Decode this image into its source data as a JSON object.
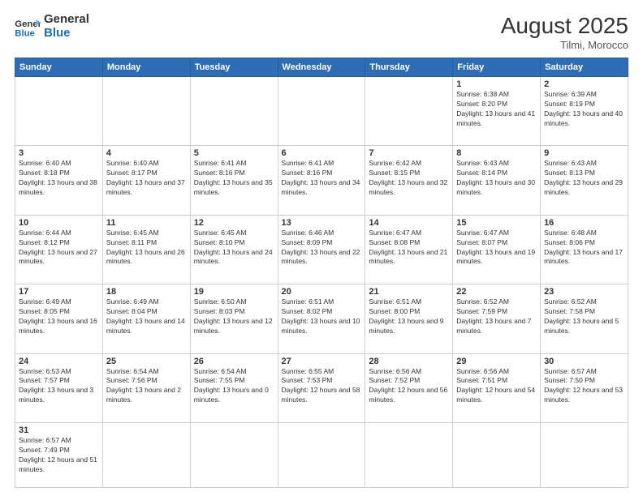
{
  "header": {
    "logo_general": "General",
    "logo_blue": "Blue",
    "month_year": "August 2025",
    "location": "Tilmi, Morocco"
  },
  "weekdays": [
    "Sunday",
    "Monday",
    "Tuesday",
    "Wednesday",
    "Thursday",
    "Friday",
    "Saturday"
  ],
  "weeks": [
    [
      {
        "day": "",
        "info": ""
      },
      {
        "day": "",
        "info": ""
      },
      {
        "day": "",
        "info": ""
      },
      {
        "day": "",
        "info": ""
      },
      {
        "day": "",
        "info": ""
      },
      {
        "day": "1",
        "info": "Sunrise: 6:38 AM\nSunset: 8:20 PM\nDaylight: 13 hours and 41 minutes."
      },
      {
        "day": "2",
        "info": "Sunrise: 6:39 AM\nSunset: 8:19 PM\nDaylight: 13 hours and 40 minutes."
      }
    ],
    [
      {
        "day": "3",
        "info": "Sunrise: 6:40 AM\nSunset: 8:18 PM\nDaylight: 13 hours and 38 minutes."
      },
      {
        "day": "4",
        "info": "Sunrise: 6:40 AM\nSunset: 8:17 PM\nDaylight: 13 hours and 37 minutes."
      },
      {
        "day": "5",
        "info": "Sunrise: 6:41 AM\nSunset: 8:16 PM\nDaylight: 13 hours and 35 minutes."
      },
      {
        "day": "6",
        "info": "Sunrise: 6:41 AM\nSunset: 8:16 PM\nDaylight: 13 hours and 34 minutes."
      },
      {
        "day": "7",
        "info": "Sunrise: 6:42 AM\nSunset: 8:15 PM\nDaylight: 13 hours and 32 minutes."
      },
      {
        "day": "8",
        "info": "Sunrise: 6:43 AM\nSunset: 8:14 PM\nDaylight: 13 hours and 30 minutes."
      },
      {
        "day": "9",
        "info": "Sunrise: 6:43 AM\nSunset: 8:13 PM\nDaylight: 13 hours and 29 minutes."
      }
    ],
    [
      {
        "day": "10",
        "info": "Sunrise: 6:44 AM\nSunset: 8:12 PM\nDaylight: 13 hours and 27 minutes."
      },
      {
        "day": "11",
        "info": "Sunrise: 6:45 AM\nSunset: 8:11 PM\nDaylight: 13 hours and 26 minutes."
      },
      {
        "day": "12",
        "info": "Sunrise: 6:45 AM\nSunset: 8:10 PM\nDaylight: 13 hours and 24 minutes."
      },
      {
        "day": "13",
        "info": "Sunrise: 6:46 AM\nSunset: 8:09 PM\nDaylight: 13 hours and 22 minutes."
      },
      {
        "day": "14",
        "info": "Sunrise: 6:47 AM\nSunset: 8:08 PM\nDaylight: 13 hours and 21 minutes."
      },
      {
        "day": "15",
        "info": "Sunrise: 6:47 AM\nSunset: 8:07 PM\nDaylight: 13 hours and 19 minutes."
      },
      {
        "day": "16",
        "info": "Sunrise: 6:48 AM\nSunset: 8:06 PM\nDaylight: 13 hours and 17 minutes."
      }
    ],
    [
      {
        "day": "17",
        "info": "Sunrise: 6:49 AM\nSunset: 8:05 PM\nDaylight: 13 hours and 16 minutes."
      },
      {
        "day": "18",
        "info": "Sunrise: 6:49 AM\nSunset: 8:04 PM\nDaylight: 13 hours and 14 minutes."
      },
      {
        "day": "19",
        "info": "Sunrise: 6:50 AM\nSunset: 8:03 PM\nDaylight: 13 hours and 12 minutes."
      },
      {
        "day": "20",
        "info": "Sunrise: 6:51 AM\nSunset: 8:02 PM\nDaylight: 13 hours and 10 minutes."
      },
      {
        "day": "21",
        "info": "Sunrise: 6:51 AM\nSunset: 8:00 PM\nDaylight: 13 hours and 9 minutes."
      },
      {
        "day": "22",
        "info": "Sunrise: 6:52 AM\nSunset: 7:59 PM\nDaylight: 13 hours and 7 minutes."
      },
      {
        "day": "23",
        "info": "Sunrise: 6:52 AM\nSunset: 7:58 PM\nDaylight: 13 hours and 5 minutes."
      }
    ],
    [
      {
        "day": "24",
        "info": "Sunrise: 6:53 AM\nSunset: 7:57 PM\nDaylight: 13 hours and 3 minutes."
      },
      {
        "day": "25",
        "info": "Sunrise: 6:54 AM\nSunset: 7:56 PM\nDaylight: 13 hours and 2 minutes."
      },
      {
        "day": "26",
        "info": "Sunrise: 6:54 AM\nSunset: 7:55 PM\nDaylight: 13 hours and 0 minutes."
      },
      {
        "day": "27",
        "info": "Sunrise: 6:55 AM\nSunset: 7:53 PM\nDaylight: 12 hours and 58 minutes."
      },
      {
        "day": "28",
        "info": "Sunrise: 6:56 AM\nSunset: 7:52 PM\nDaylight: 12 hours and 56 minutes."
      },
      {
        "day": "29",
        "info": "Sunrise: 6:56 AM\nSunset: 7:51 PM\nDaylight: 12 hours and 54 minutes."
      },
      {
        "day": "30",
        "info": "Sunrise: 6:57 AM\nSunset: 7:50 PM\nDaylight: 12 hours and 53 minutes."
      }
    ],
    [
      {
        "day": "31",
        "info": "Sunrise: 6:57 AM\nSunset: 7:49 PM\nDaylight: 12 hours and 51 minutes."
      },
      {
        "day": "",
        "info": ""
      },
      {
        "day": "",
        "info": ""
      },
      {
        "day": "",
        "info": ""
      },
      {
        "day": "",
        "info": ""
      },
      {
        "day": "",
        "info": ""
      },
      {
        "day": "",
        "info": ""
      }
    ]
  ]
}
